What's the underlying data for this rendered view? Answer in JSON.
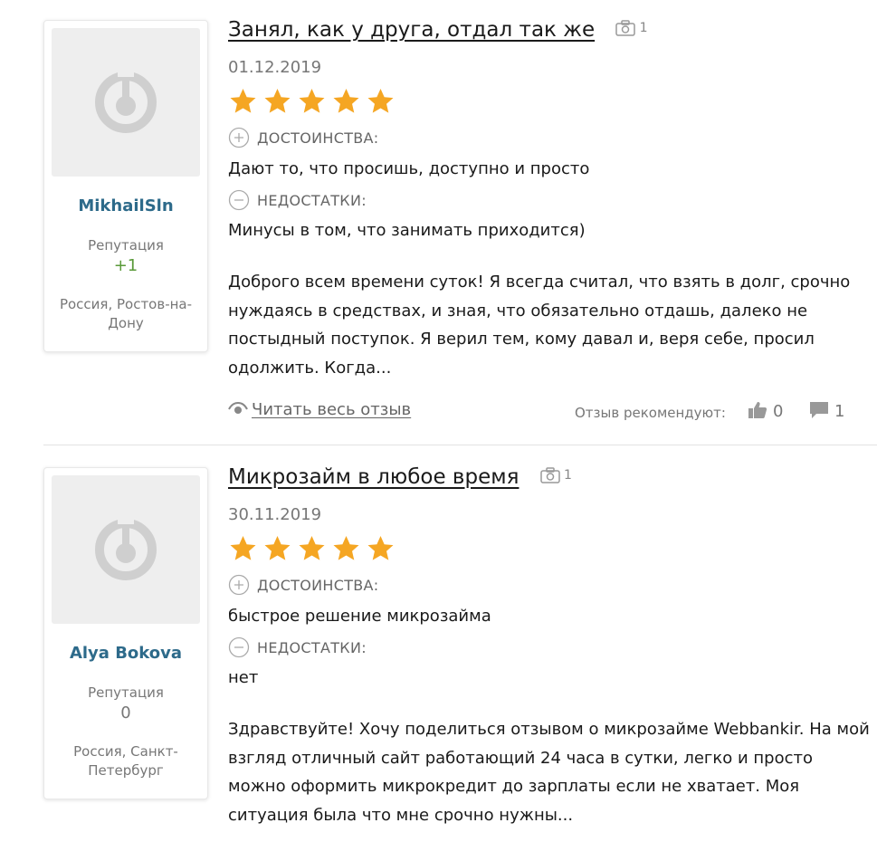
{
  "reviews": [
    {
      "author": {
        "name": "MikhailSln",
        "reputation_label": "Репутация",
        "reputation_value": "+1",
        "location": "Россия, Ростов-на-Дону"
      },
      "title": "Занял, как у друга, отдал так же",
      "photo_count": "1",
      "date": "01.12.2019",
      "rating": 5,
      "pros_label": "ДОСТОИНСТВА:",
      "pros_text": "Дают то, что просишь, доступно и просто",
      "cons_label": "НЕДОСТАТКИ:",
      "cons_text": "Минусы в том, что занимать приходится)",
      "body": "Доброго всем времени суток! Я всегда считал, что взять в долг, срочно нуждаясь в средствах, и зная, что обязательно отдашь, далеко не постыдный поступок. Я верил тем, кому давал и, веря себе, просил одолжить. Когда...",
      "read_more_label": "Читать весь отзыв",
      "recommend_label": "Отзыв рекомендуют:",
      "likes": "0",
      "comments": "1"
    },
    {
      "author": {
        "name": "Alya Bokova",
        "reputation_label": "Репутация",
        "reputation_value": "0",
        "location": "Россия, Санкт-Петербург"
      },
      "title": "Микрозайм в любое время",
      "photo_count": "1",
      "date": "30.11.2019",
      "rating": 5,
      "pros_label": "ДОСТОИНСТВА:",
      "pros_text": "быстрое решение микрозайма",
      "cons_label": "НЕДОСТАТКИ:",
      "cons_text": "нет",
      "body": "Здравствуйте! Хочу поделиться отзывом о микрозайме Webbankir. На мой взгляд отличный сайт работающий 24 часа в сутки, легко и просто можно оформить микрокредит до зарплаты если не хватает. Моя ситуация была что мне срочно нужны..."
    }
  ],
  "colors": {
    "star": "#f5a623",
    "author_name": "#2d6a8a",
    "reputation_positive": "#5a9a3a",
    "muted": "#777777"
  },
  "icons": [
    "avatar-placeholder-icon",
    "camera-icon",
    "star-icon",
    "plus-circle-icon",
    "minus-circle-icon",
    "eye-icon",
    "thumbs-up-icon",
    "comment-icon"
  ]
}
